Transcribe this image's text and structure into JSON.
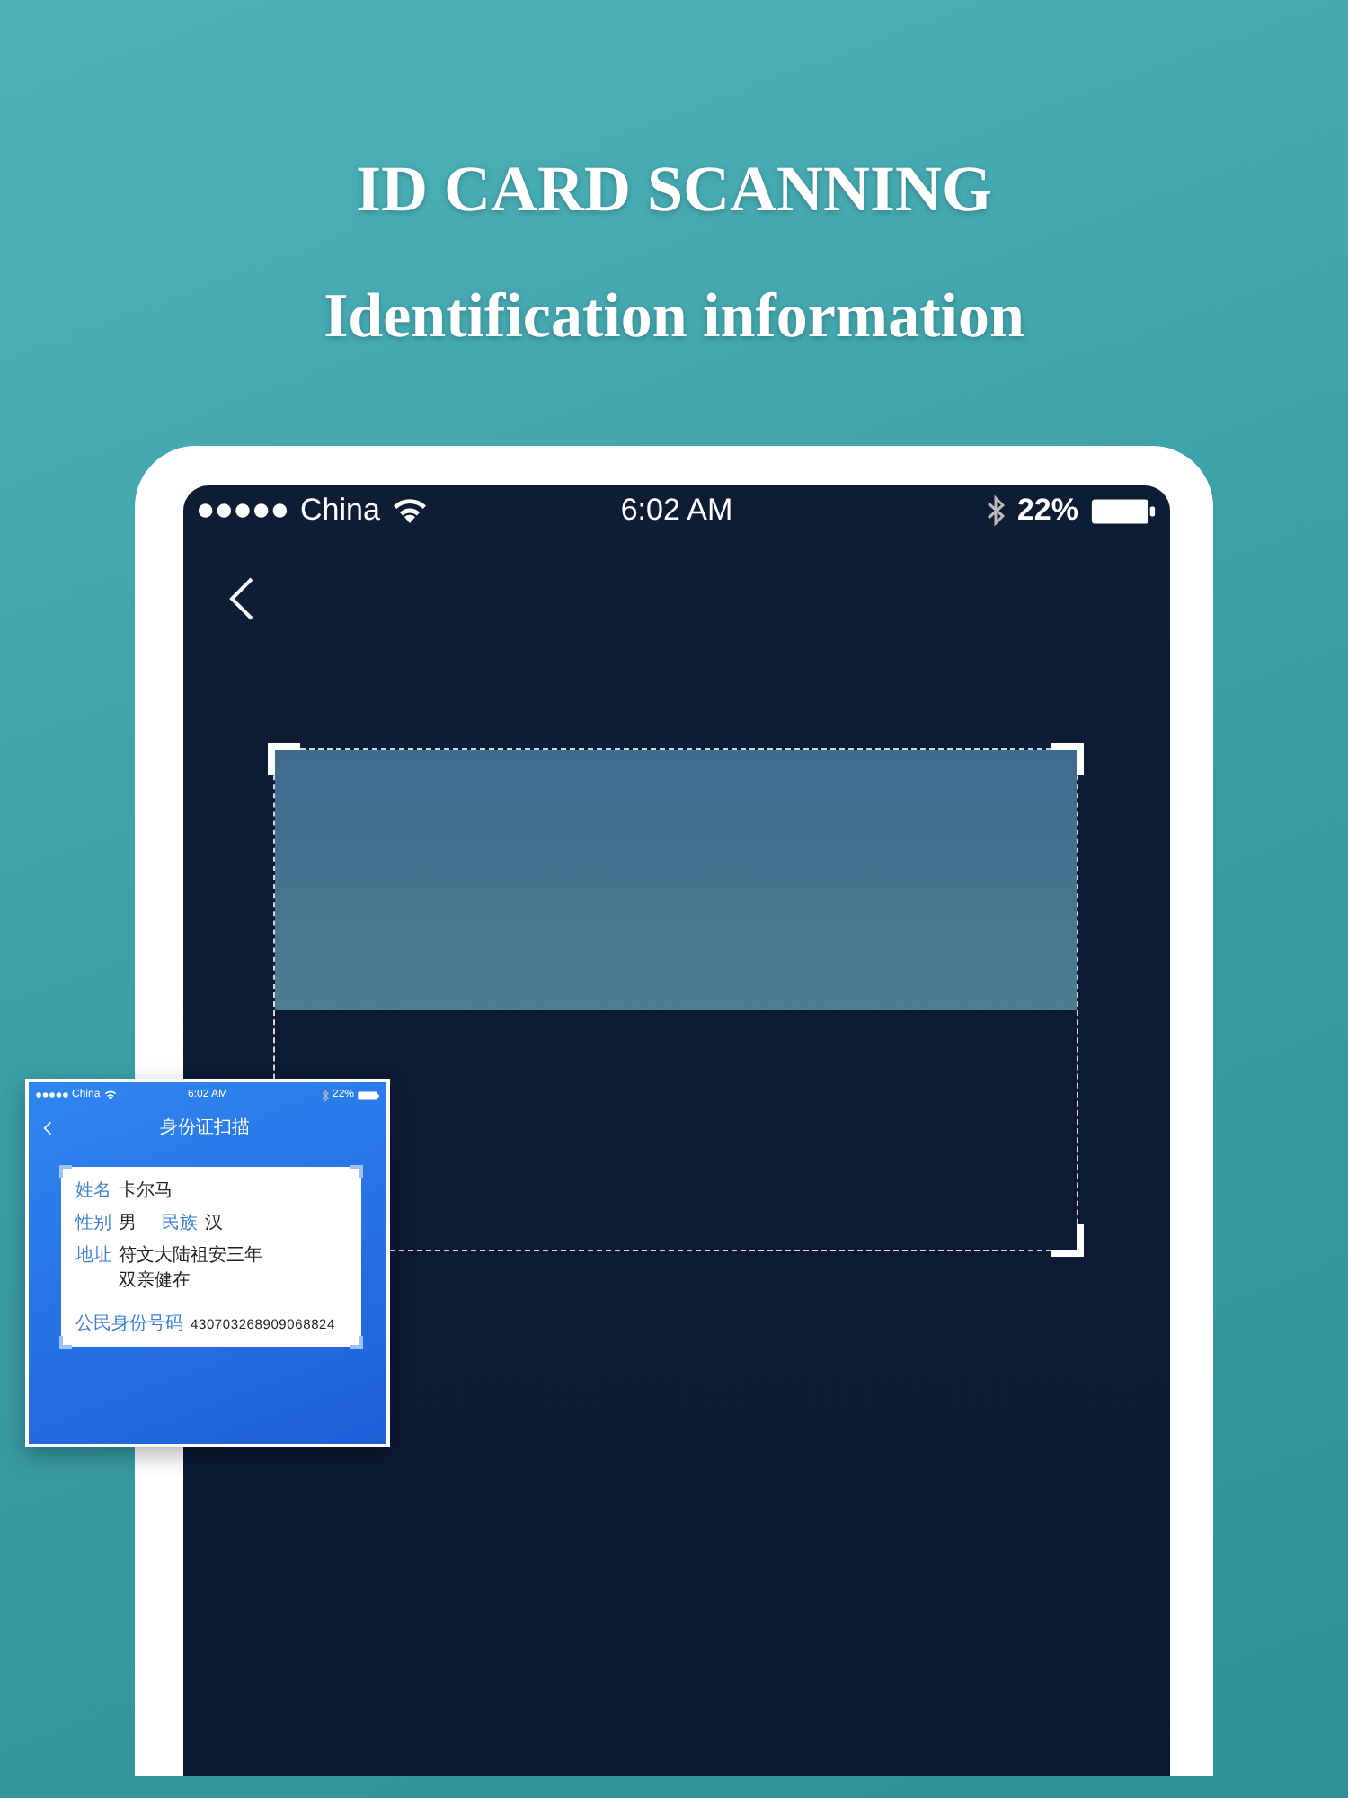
{
  "heading": {
    "title": "ID CARD SCANNING",
    "subtitle": "Identification information"
  },
  "status_bar": {
    "carrier": "China",
    "time": "6:02 AM",
    "battery": "22%"
  },
  "result_card": {
    "status_bar": {
      "carrier": "China",
      "time": "6:02 AM",
      "battery": "22%"
    },
    "title": "身份证扫描",
    "rows": [
      {
        "kind": "pair",
        "items": [
          {
            "label": "姓名",
            "value": [
              "卡尔马"
            ]
          }
        ]
      },
      {
        "kind": "pair",
        "items": [
          {
            "label": "性别",
            "value": [
              "男"
            ]
          },
          {
            "label": "民族",
            "value": [
              "汉"
            ]
          }
        ]
      },
      {
        "kind": "pair",
        "items": [
          {
            "label": "地址",
            "value": [
              "符文大陆祖安三年",
              "双亲健在"
            ]
          }
        ]
      },
      {
        "kind": "id",
        "items": [
          {
            "label": "公民身份号码",
            "value": [
              "430703268909068824"
            ]
          }
        ]
      }
    ]
  }
}
